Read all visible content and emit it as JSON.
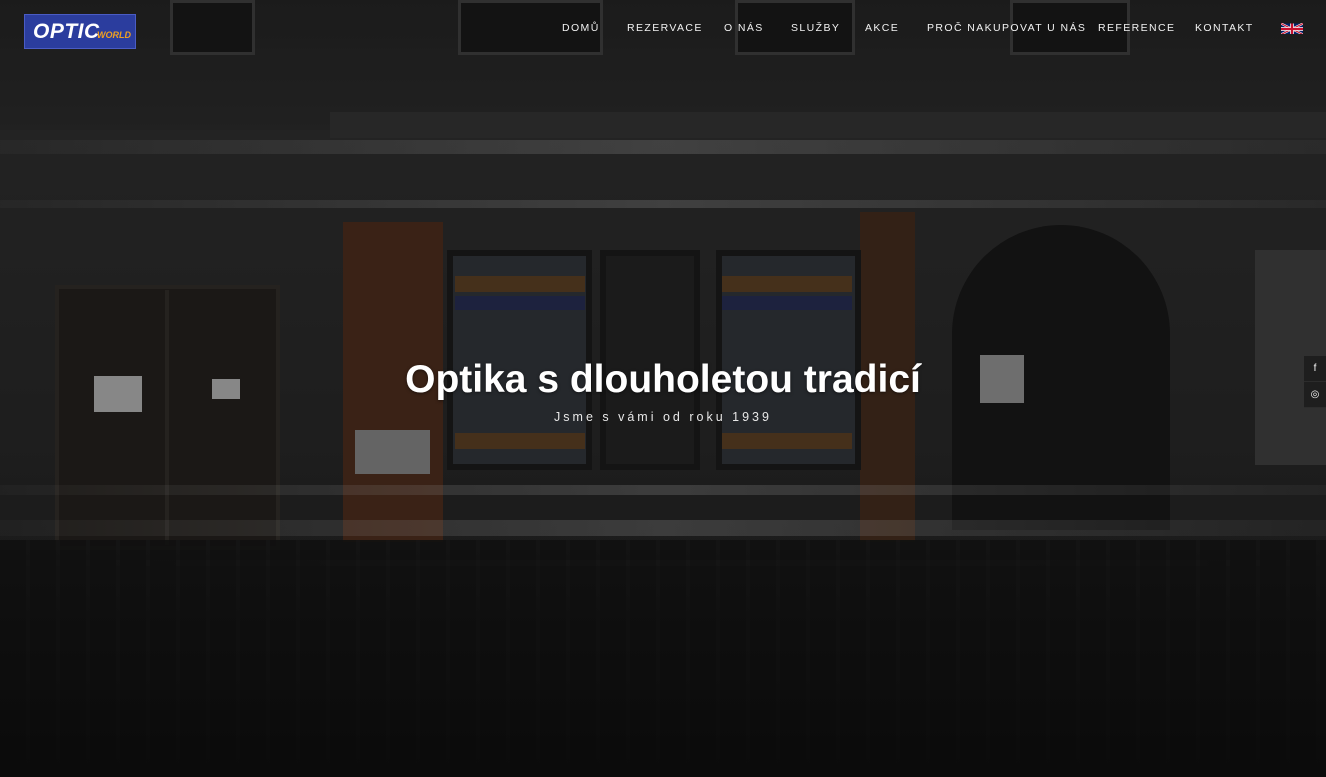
{
  "brand": {
    "logo_main": "OPTIC",
    "logo_sub": "WORLD"
  },
  "nav": {
    "items": [
      {
        "label": "DOMŮ"
      },
      {
        "label": "REZERVACE"
      },
      {
        "label": "O NÁS"
      },
      {
        "label": "SLUŽBY"
      },
      {
        "label": "AKCE"
      },
      {
        "label": "PROČ NAKUPOVAT U NÁS"
      },
      {
        "label": "REFERENCE"
      },
      {
        "label": "KONTAKT"
      }
    ],
    "language_flag": "uk-flag-icon"
  },
  "hero": {
    "title": "Optika s dlouholetou tradicí",
    "subtitle": "Jsme s vámi od roku 1939"
  },
  "social": {
    "facebook_glyph": "f",
    "instagram_glyph": "◎"
  },
  "colors": {
    "logo_bg": "#2b3d9e",
    "logo_accent": "#f0a020",
    "nav_text": "#f2f2f2"
  }
}
